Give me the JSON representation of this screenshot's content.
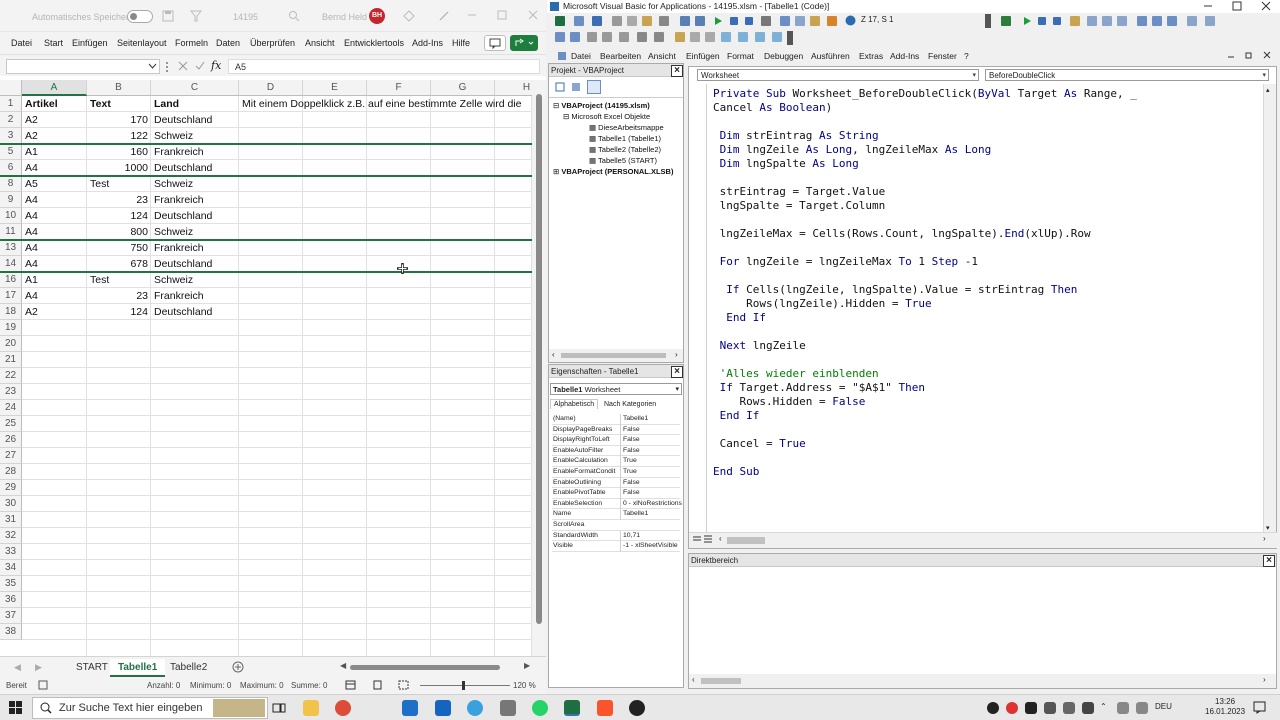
{
  "excel": {
    "titlebar": {
      "autosave_label": "Automatisches Speichern",
      "filename": "14195",
      "user_name": "Bernd Held",
      "user_initials": "BH"
    },
    "ribbon_tabs": [
      "Datei",
      "Start",
      "Einfügen",
      "Seitenlayout",
      "Formeln",
      "Daten",
      "Überprüfen",
      "Ansicht",
      "Entwicklertools",
      "Add-Ins",
      "Hilfe"
    ],
    "formula_bar": {
      "name_box": "",
      "fx": "fx",
      "content": "A5"
    },
    "columns": [
      "A",
      "B",
      "C",
      "D",
      "E",
      "F",
      "G",
      "H"
    ],
    "selected_column": "A",
    "rows": [
      {
        "num": "1",
        "a": "Artikel",
        "b": "Text",
        "c": "Land",
        "d": "Mit einem Doppelklick z.B. auf eine bestimmte Zelle wird die"
      },
      {
        "num": "2",
        "a": "A2",
        "b": "170",
        "c": "Deutschland"
      },
      {
        "num": "3",
        "a": "A2",
        "b": "122",
        "c": "Schweiz"
      },
      {
        "num": "5",
        "a": "A1",
        "b": "160",
        "c": "Frankreich"
      },
      {
        "num": "6",
        "a": "A4",
        "b": "1000",
        "c": "Deutschland"
      },
      {
        "num": "8",
        "a": "A5",
        "b": "Test",
        "c": "Schweiz"
      },
      {
        "num": "9",
        "a": "A4",
        "b": "23",
        "c": "Frankreich"
      },
      {
        "num": "10",
        "a": "A4",
        "b": "124",
        "c": "Deutschland"
      },
      {
        "num": "11",
        "a": "A4",
        "b": "800",
        "c": "Schweiz"
      },
      {
        "num": "13",
        "a": "A4",
        "b": "750",
        "c": "Frankreich"
      },
      {
        "num": "14",
        "a": "A4",
        "b": "678",
        "c": "Deutschland"
      },
      {
        "num": "16",
        "a": "A1",
        "b": "Test",
        "c": "Schweiz"
      },
      {
        "num": "17",
        "a": "A4",
        "b": "23",
        "c": "Frankreich"
      },
      {
        "num": "18",
        "a": "A2",
        "b": "124",
        "c": "Deutschland"
      },
      {
        "num": "19"
      },
      {
        "num": "20"
      },
      {
        "num": "21"
      },
      {
        "num": "22"
      },
      {
        "num": "23"
      },
      {
        "num": "24"
      },
      {
        "num": "25"
      },
      {
        "num": "26"
      },
      {
        "num": "27"
      },
      {
        "num": "28"
      },
      {
        "num": "29"
      },
      {
        "num": "30"
      },
      {
        "num": "31"
      },
      {
        "num": "32"
      },
      {
        "num": "33"
      },
      {
        "num": "34"
      },
      {
        "num": "35"
      },
      {
        "num": "36"
      },
      {
        "num": "37"
      },
      {
        "num": "38"
      }
    ],
    "sheet_tabs": [
      "START",
      "Tabelle1",
      "Tabelle2"
    ],
    "active_sheet": "Tabelle1",
    "status": {
      "ready": "Bereit",
      "count": "Anzahl: 0",
      "min": "Minimum: 0",
      "max": "Maximum: 0",
      "sum": "Summe: 0",
      "zoom": "120 %"
    }
  },
  "vba": {
    "title": "Microsoft Visual Basic for Applications - 14195.xlsm - [Tabelle1 (Code)]",
    "position": "Z 17, S 1",
    "menu": [
      "Datei",
      "Bearbeiten",
      "Ansicht",
      "Einfügen",
      "Format",
      "Debuggen",
      "Ausführen",
      "Extras",
      "Add-Ins",
      "Fenster",
      "?"
    ],
    "project": {
      "header": "Projekt - VBAProject",
      "tree": [
        "VBAProject (14195.xlsm)",
        "Microsoft Excel Objekte",
        "DieseArbeitsmappe",
        "Tabelle1 (Tabelle1)",
        "Tabelle2 (Tabelle2)",
        "Tabelle5 (START)",
        "VBAProject (PERSONAL.XLSB)"
      ]
    },
    "properties": {
      "header": "Eigenschaften - Tabelle1",
      "object_name": "Tabelle1",
      "object_type": "Worksheet",
      "tabs": [
        "Alphabetisch",
        "Nach Kategorien"
      ],
      "rows": [
        {
          "k": "(Name)",
          "v": "Tabelle1"
        },
        {
          "k": "DisplayPageBreaks",
          "v": "False"
        },
        {
          "k": "DisplayRightToLeft",
          "v": "False"
        },
        {
          "k": "EnableAutoFilter",
          "v": "False"
        },
        {
          "k": "EnableCalculation",
          "v": "True"
        },
        {
          "k": "EnableFormatCondit",
          "v": "True"
        },
        {
          "k": "EnableOutlining",
          "v": "False"
        },
        {
          "k": "EnablePivotTable",
          "v": "False"
        },
        {
          "k": "EnableSelection",
          "v": "0 - xlNoRestrictions"
        },
        {
          "k": "Name",
          "v": "Tabelle1"
        },
        {
          "k": "ScrollArea",
          "v": ""
        },
        {
          "k": "StandardWidth",
          "v": "10,71"
        },
        {
          "k": "Visible",
          "v": "-1 - xlSheetVisible"
        }
      ]
    },
    "code": {
      "object": "Worksheet",
      "procedure": "BeforeDoubleClick",
      "lines": [
        "Private Sub Worksheet_BeforeDoubleClick(ByVal Target As Range, _",
        "Cancel As Boolean)",
        "",
        " Dim strEintrag As String",
        " Dim lngZeile As Long, lngZeileMax As Long",
        " Dim lngSpalte As Long",
        "",
        " strEintrag = Target.Value",
        " lngSpalte = Target.Column",
        "",
        " lngZeileMax = Cells(Rows.Count, lngSpalte).End(xlUp).Row",
        "",
        " For lngZeile = lngZeileMax To 1 Step -1",
        "",
        "  If Cells(lngZeile, lngSpalte).Value = strEintrag Then",
        "     Rows(lngZeile).Hidden = True",
        "  End If",
        "",
        " Next lngZeile",
        "",
        " 'Alles wieder einblenden",
        " If Target.Address = \"$A$1\" Then",
        "    Rows.Hidden = False",
        " End If",
        "",
        " Cancel = True",
        "",
        "End Sub"
      ]
    },
    "direct_header": "Direktbereich"
  },
  "taskbar": {
    "search_placeholder": "Zur Suche Text hier eingeben",
    "lang": "DEU",
    "time": "13:26",
    "date": "16.01.2023"
  }
}
